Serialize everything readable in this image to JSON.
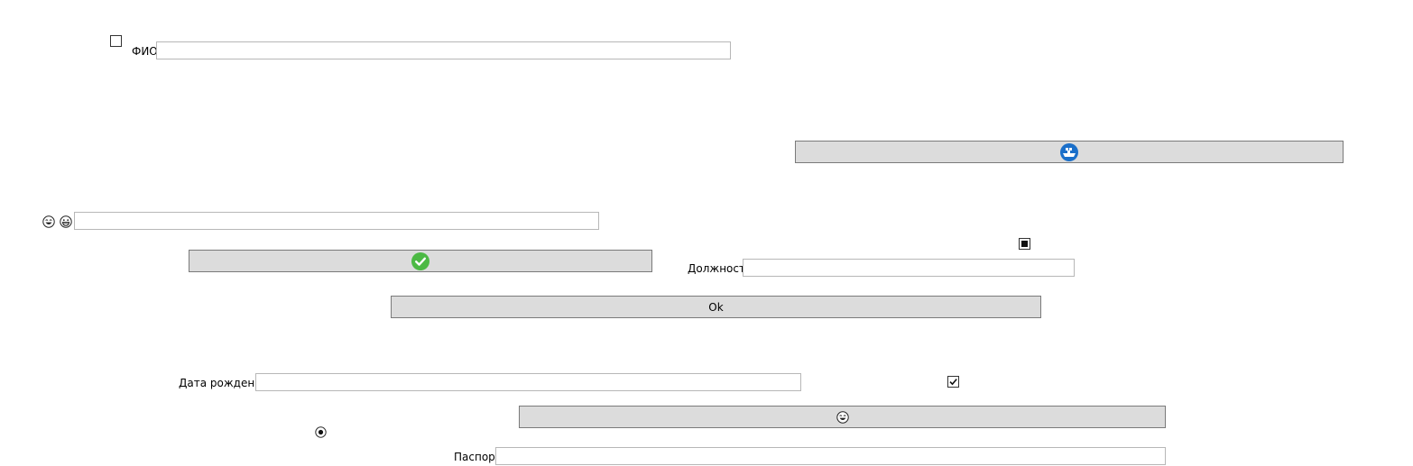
{
  "form": {
    "fio_label": "ФИО",
    "fio_value": "",
    "dolzhnost_label": "Должность",
    "dolzhnost_value": "",
    "data_rozhdeniya_label": "Дата рождения",
    "data_rozhdeniya_value": "",
    "pasport_label": "Паспорт",
    "pasport_value": "",
    "emoji_input_value": ""
  },
  "buttons": {
    "ok_label": "Ok",
    "ship_icon": "ship-icon",
    "check_icon": "check-circle-icon",
    "laugh_icon": "laughing-face-icon"
  },
  "controls": {
    "checkbox_top_checked": false,
    "checkbox_square_state": "indeterminate",
    "checkbox_checked": true,
    "radio_selected": true
  },
  "colors": {
    "button_bg": "#dcdcdc",
    "check_green": "#4cb944",
    "ship_blue": "#1a6fc9"
  }
}
